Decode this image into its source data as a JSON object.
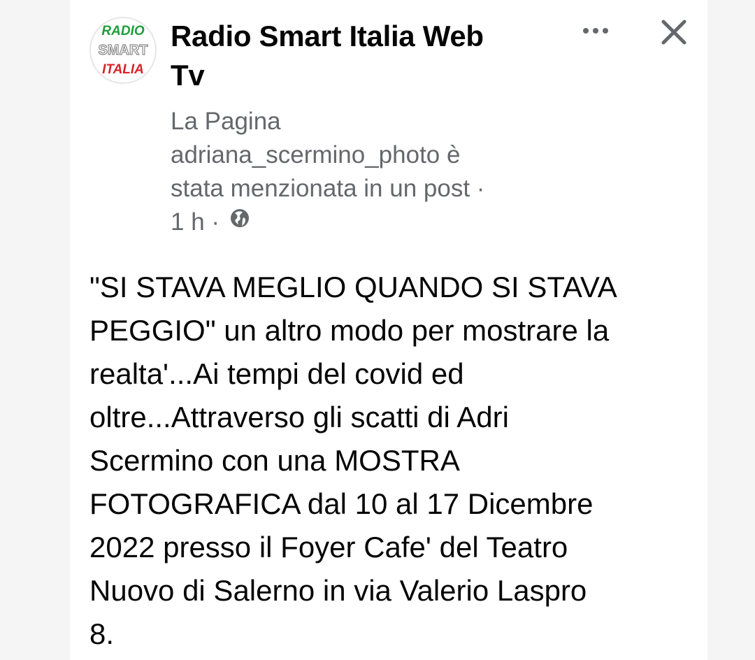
{
  "post": {
    "author": {
      "name_line1": "Radio Smart Italia Web",
      "name_line2": "Tv",
      "avatar_logo": {
        "line1": "RADIO",
        "line2": "SMART",
        "line3": "ITALIA",
        "icon": "radio-smart-italia-logo"
      }
    },
    "meta": {
      "line1": "La Pagina",
      "line2": "adriana_scermino_photo è",
      "line3": "stata menzionata in un post ·",
      "time": "1 h",
      "separator": " · ",
      "privacy_icon": "globe-icon"
    },
    "actions": {
      "more_icon": "more-options-icon",
      "close_icon": "close-icon"
    },
    "text_lines": [
      "\"SI STAVA MEGLIO QUANDO SI STAVA",
      "PEGGIO\" un altro modo per mostrare la",
      "realta'...Ai tempi del covid ed",
      "oltre...Attraverso gli scatti di Adri",
      "Scermino con una MOSTRA",
      "FOTOGRAFICA dal 10 al 17 Dicembre",
      "2022 presso il Foyer Cafe' del Teatro",
      "Nuovo di Salerno in via Valerio Laspro",
      "8."
    ]
  },
  "colors": {
    "text_primary": "#050505",
    "text_secondary": "#65676b",
    "logo_green": "#1f9d3a",
    "logo_red": "#d8232a",
    "logo_grey": "#8a8a8a"
  }
}
